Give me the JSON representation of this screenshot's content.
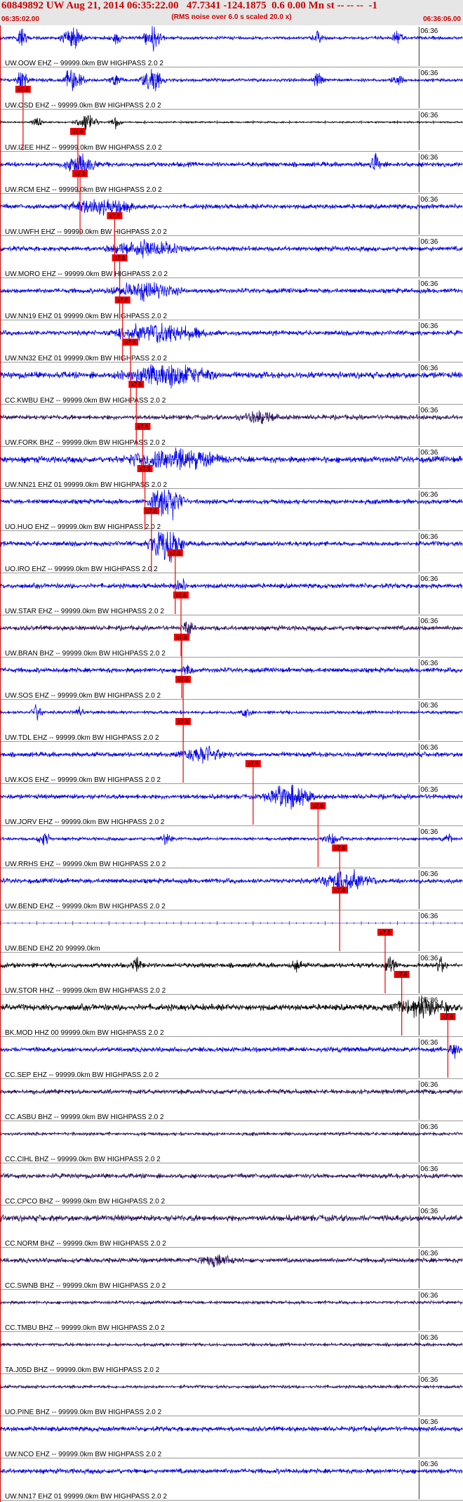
{
  "header": {
    "title": "60849892 UW Aug 21, 2014 06:35:22.00   47.7341 -124.1875  0.6 0.00 Mn st -- -- --  -1",
    "subtitle": "(RMS noise over 6.0 s scaled 20.0 x)",
    "start_time": "06:35:02.00",
    "end_time": "06:36:06.00"
  },
  "chart_data": {
    "type": "line",
    "title": "60849892 UW Aug 21, 2014 06:35:22.00   47.7341 -124.1875  0.6 0.00 Mn st -- -- --  -1",
    "subtitle": "(RMS noise over 6.0 s scaled 20.0 x)",
    "x_range": [
      "06:35:02.00",
      "06:36:06.00"
    ],
    "tick_label": "06:36",
    "pick_label": "x7.6",
    "colors": {
      "blue": "#0000ee",
      "black": "#000000",
      "purple": "#2a1060",
      "pick": "#ee0000"
    },
    "series": [
      {
        "name": "UW.OOW EHZ -- 99999.0km BW  HIGHPASS  2.0  2",
        "color": "blue",
        "amp": 2,
        "bursts": [
          [
            3,
            1,
            14
          ],
          [
            10,
            2,
            14
          ],
          [
            16,
            1,
            8
          ],
          [
            21,
            2,
            14
          ],
          [
            44,
            1,
            8
          ],
          [
            55,
            1,
            8
          ]
        ],
        "pick": null
      },
      {
        "name": "UW.OSD EHZ -- 99999.0km BW  HIGHPASS  2.0  2",
        "color": "blue",
        "amp": 2,
        "bursts": [
          [
            3,
            1,
            14
          ],
          [
            10,
            2,
            14
          ],
          [
            16,
            1,
            8
          ],
          [
            21,
            2,
            14
          ],
          [
            44,
            1,
            8
          ],
          [
            55,
            1,
            8
          ]
        ],
        "pick": null
      },
      {
        "name": "UW.IZEE HHZ -- 99999.0km BW  HIGHPASS  2.0  2",
        "color": "black",
        "amp": 1,
        "bursts": [
          [
            5,
            1,
            6
          ],
          [
            12,
            2,
            10
          ],
          [
            16,
            1,
            8
          ]
        ],
        "pick": 3.1
      },
      {
        "name": "UW.RCM EHZ -- 99999.0km BW  HIGHPASS  2.0  2",
        "color": "blue",
        "amp": 3,
        "bursts": [
          [
            11,
            3,
            12
          ],
          [
            52,
            1,
            10
          ]
        ],
        "pick": 10.7
      },
      {
        "name": "UW.UWFH EHZ -- 99999.0km BW  HIGHPASS  2.0  2",
        "color": "blue",
        "amp": 3,
        "bursts": [
          [
            14,
            6,
            10
          ]
        ],
        "pick": 11.0
      },
      {
        "name": "UW.MORO EHZ -- 99999.0km BW  HIGHPASS  2.0  2",
        "color": "blue",
        "amp": 3,
        "bursts": [
          [
            20,
            6,
            10
          ]
        ],
        "pick": 15.8
      },
      {
        "name": "UW.NN19 EHZ 01 99999.0km BW  HIGHPASS  2.0  2",
        "color": "blue",
        "amp": 3,
        "bursts": [
          [
            20,
            6,
            10
          ]
        ],
        "pick": 16.5
      },
      {
        "name": "UW.NN32 EHZ 01 99999.0km BW  HIGHPASS  2.0  2",
        "color": "blue",
        "amp": 3,
        "bursts": [
          [
            22,
            8,
            12
          ]
        ],
        "pick": 16.9
      },
      {
        "name": "CC.KWBU EHZ -- 99999.0km BW  HIGHPASS  2.0  2",
        "color": "blue",
        "amp": 4,
        "bursts": [
          [
            23,
            8,
            14
          ]
        ],
        "pick": 18.0
      },
      {
        "name": "UW.FORK BHZ -- 99999.0km BW  HIGHPASS  2.0  2",
        "color": "purple",
        "amp": 3,
        "bursts": [
          [
            36,
            4,
            6
          ]
        ],
        "pick": 18.8
      },
      {
        "name": "UW.NN21 EHZ 01 99999.0km BW  HIGHPASS  2.0  2",
        "color": "blue",
        "amp": 4,
        "bursts": [
          [
            24,
            8,
            14
          ]
        ],
        "pick": 19.7
      },
      {
        "name": "UO.HUO EHZ -- 99999.0km BW  HIGHPASS  2.0  2",
        "color": "blue",
        "amp": 3,
        "bursts": [
          [
            23,
            3,
            24
          ]
        ],
        "pick": 20.0
      },
      {
        "name": "UO.IRO EHZ -- 99999.0km BW  HIGHPASS  2.0  2",
        "color": "blue",
        "amp": 3,
        "bursts": [
          [
            23,
            3,
            24
          ]
        ],
        "pick": 20.9
      },
      {
        "name": "UW.STAR EHZ -- 99999.0km BW  HIGHPASS  2.0  2",
        "color": "blue",
        "amp": 3,
        "bursts": [
          [
            25,
            1,
            10
          ]
        ],
        "pick": 24.2
      },
      {
        "name": "UW.BRAN BHZ -- 99999.0km BW  HIGHPASS  2.0  2",
        "color": "purple",
        "amp": 3,
        "bursts": [
          [
            26,
            1,
            10
          ]
        ],
        "pick": 25.0
      },
      {
        "name": "UW.SOS EHZ -- 99999.0km BW  HIGHPASS  2.0  2",
        "color": "blue",
        "amp": 3,
        "bursts": [
          [
            26,
            1,
            6
          ]
        ],
        "pick": 25.1
      },
      {
        "name": "UW.TDL EHZ -- 99999.0km BW  HIGHPASS  2.0  2",
        "color": "blue",
        "amp": 2,
        "bursts": [
          [
            5,
            1,
            10
          ],
          [
            11,
            1,
            6
          ],
          [
            34,
            1,
            5
          ]
        ],
        "pick": 25.3
      },
      {
        "name": "UW.KOS EHZ -- 99999.0km BW  HIGHPASS  2.0  2",
        "color": "blue",
        "amp": 3,
        "bursts": [
          [
            28,
            4,
            10
          ]
        ],
        "pick": 25.3
      },
      {
        "name": "UW.JORV EHZ -- 99999.0km BW  HIGHPASS  2.0  2",
        "color": "blue",
        "amp": 3,
        "bursts": [
          [
            40,
            4,
            16
          ]
        ],
        "pick": 35.0
      },
      {
        "name": "UW.RRHS EHZ -- 99999.0km BW  HIGHPASS  2.0  2",
        "color": "blue",
        "amp": 2,
        "bursts": [
          [
            6,
            1,
            10
          ],
          [
            23,
            1,
            10
          ],
          [
            46,
            2,
            6
          ],
          [
            62,
            1,
            6
          ]
        ],
        "pick": 44.0
      },
      {
        "name": "UW.BEND EHZ -- 99999.0km BW  HIGHPASS  2.0  2",
        "color": "blue",
        "amp": 3,
        "bursts": [
          [
            48,
            5,
            12
          ]
        ],
        "pick": 47.0
      },
      {
        "name": "UW.BEND EHZ 20 99999.0km",
        "color": "blue",
        "amp": 0,
        "bursts": [],
        "pick": 47.0
      },
      {
        "name": "UW.STOR HHZ -- 99999.0km BW  HIGHPASS  2.0  2",
        "color": "black",
        "amp": 3,
        "bursts": [
          [
            19,
            1,
            8
          ],
          [
            41,
            1,
            6
          ],
          [
            54,
            1,
            12
          ],
          [
            61,
            1,
            10
          ]
        ],
        "pick": 53.3
      },
      {
        "name": "BK.MOD HHZ 00 99999.0km BW  HIGHPASS  2.0  2",
        "color": "black",
        "amp": 4,
        "bursts": [
          [
            58,
            5,
            12
          ]
        ],
        "pick": 55.6
      },
      {
        "name": "CC.SEP EHZ -- 99999.0km BW  HIGHPASS  2.0  2",
        "color": "blue",
        "amp": 3,
        "bursts": [
          [
            63,
            1,
            14
          ]
        ],
        "pick": 62.0
      },
      {
        "name": "CC.ASBU BHZ -- 99999.0km BW  HIGHPASS  2.0  2",
        "color": "purple",
        "amp": 3,
        "bursts": [],
        "pick": null
      },
      {
        "name": "CC.CIHL BHZ -- 99999.0km BW  HIGHPASS  2.0  2",
        "color": "purple",
        "amp": 2,
        "bursts": [],
        "pick": null
      },
      {
        "name": "CC.CPCO BHZ -- 99999.0km BW  HIGHPASS  2.0  2",
        "color": "purple",
        "amp": 3,
        "bursts": [],
        "pick": null
      },
      {
        "name": "CC.NORM BHZ -- 99999.0km BW  HIGHPASS  2.0  2",
        "color": "purple",
        "amp": 4,
        "bursts": [],
        "pick": null
      },
      {
        "name": "CC.SWNB BHZ -- 99999.0km BW  HIGHPASS  2.0  2",
        "color": "purple",
        "amp": 3,
        "bursts": [
          [
            30,
            4,
            5
          ]
        ],
        "pick": null
      },
      {
        "name": "CC.TMBU BHZ -- 99999.0km BW  HIGHPASS  2.0  2",
        "color": "purple",
        "amp": 2,
        "bursts": [],
        "pick": null
      },
      {
        "name": "TA.J05D BHZ -- 99999.0km BW  HIGHPASS  2.0  2",
        "color": "purple",
        "amp": 2,
        "bursts": [],
        "pick": null
      },
      {
        "name": "UO.PINE BHZ -- 99999.0km BW  HIGHPASS  2.0  2",
        "color": "purple",
        "amp": 2,
        "bursts": [],
        "pick": null
      },
      {
        "name": "UW.NCO EHZ -- 99999.0km BW  HIGHPASS  2.0  2",
        "color": "blue",
        "amp": 3,
        "bursts": [],
        "pick": null
      },
      {
        "name": "UW.NN17 EHZ 01 99999.0km BW  HIGHPASS  2.0  2",
        "color": "blue",
        "amp": 3,
        "bursts": [],
        "pick": null
      }
    ]
  }
}
